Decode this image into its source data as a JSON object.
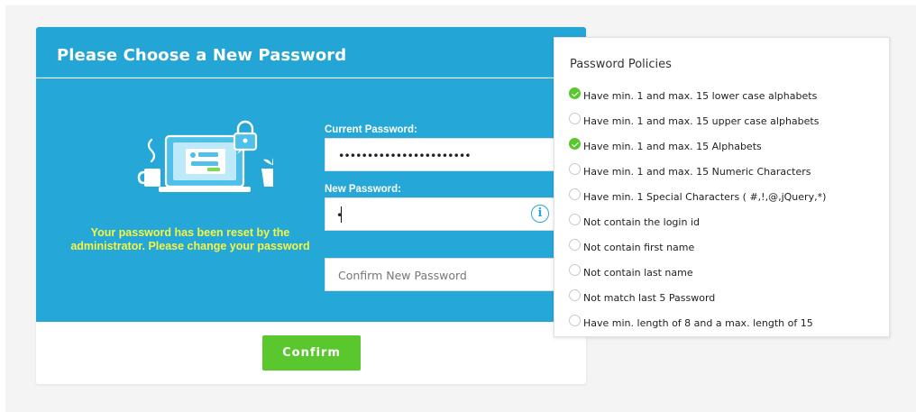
{
  "header": {
    "title": "Please Choose a New Password"
  },
  "message": "Your password has been reset by the administrator. Please change your password",
  "fields": {
    "current": {
      "label": "Current Password:",
      "value": "•••••••••••••••••••••••"
    },
    "new": {
      "label": "New Password:",
      "value": "•"
    },
    "confirm": {
      "placeholder": "Confirm New Password"
    }
  },
  "confirm_label": "Confirm",
  "info_icon": "i",
  "policies": {
    "title": "Password Policies",
    "items": [
      {
        "text": "Have min. 1 and max. 15 lower case alphabets",
        "met": true
      },
      {
        "text": "Have min. 1 and max. 15 upper case alphabets",
        "met": false
      },
      {
        "text": "Have min. 1 and max. 15 Alphabets",
        "met": true
      },
      {
        "text": "Have min. 1 and max. 15 Numeric Characters",
        "met": false
      },
      {
        "text": "Have min. 1 Special Characters ( #,!,@,jQuery,*)",
        "met": false
      },
      {
        "text": "Not contain the login id",
        "met": false
      },
      {
        "text": "Not contain first name",
        "met": false
      },
      {
        "text": "Not contain last name",
        "met": false
      },
      {
        "text": "Not match last 5 Password",
        "met": false
      },
      {
        "text": "Have min. length of 8 and a max. length of 15",
        "met": false
      }
    ]
  },
  "colors": {
    "header_blue": "#23a5d6",
    "body_blue": "#25a7d8",
    "message_yellow": "#f5f542",
    "button_green": "#5bc72f",
    "check_green": "#5bc72f"
  }
}
